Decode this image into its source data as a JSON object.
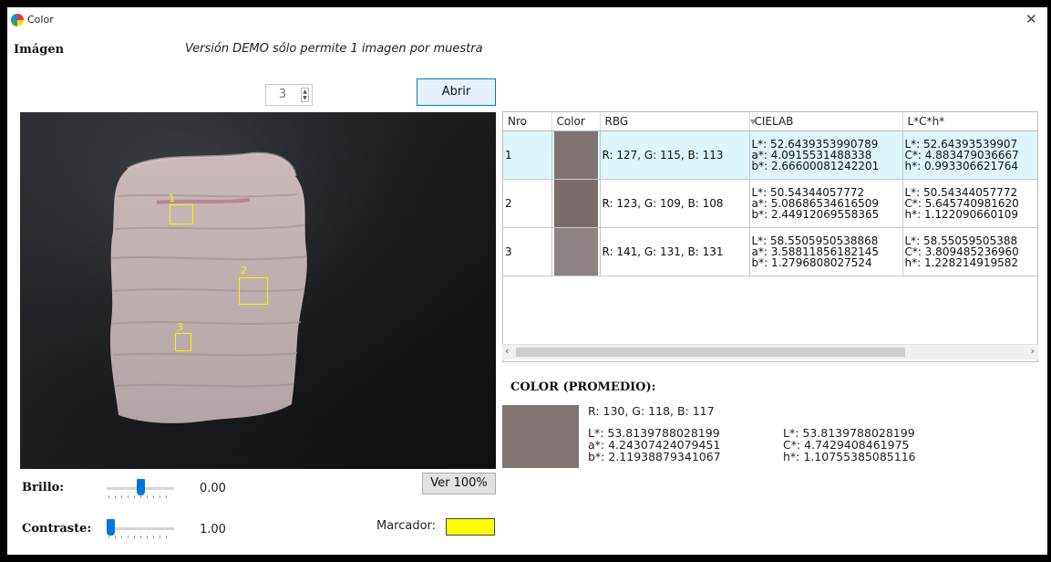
{
  "window": {
    "title": "Color",
    "close_glyph": "✕"
  },
  "image_section": {
    "label": "Imágen",
    "demo_note": "Versión DEMO sólo permite 1 imagen por muestra",
    "sample_count": "3",
    "open_button": "Abrir",
    "view_100_button": "Ver 100%"
  },
  "photo": {
    "markers": [
      {
        "label": "1"
      },
      {
        "label": "2"
      },
      {
        "label": "3"
      }
    ]
  },
  "controls": {
    "brightness_label": "Brillo:",
    "brightness_value": "0.00",
    "brightness_level": 0.5,
    "contrast_label": "Contraste:",
    "contrast_value": "1.00",
    "contrast_level": 0.0,
    "marker_label": "Marcador:",
    "marker_color": "#ffff00"
  },
  "table": {
    "columns": [
      "Nro",
      "Color",
      "RBG",
      "CIELAB",
      "L*C*h*"
    ],
    "rows": [
      {
        "nro": "1",
        "color": "#7f7371",
        "rgb": "R: 127, G: 115, B: 113",
        "lab": [
          "L*: 52.6439353990789",
          "a*: 4.0915531488338",
          "b*: 2.66600081242201"
        ],
        "lch": [
          "L*: 52.64393539907",
          "C*: 4.883479036667",
          "h*: 0.993306621764"
        ],
        "selected": true
      },
      {
        "nro": "2",
        "color": "#7b6d6c",
        "rgb": "R: 123, G: 109, B: 108",
        "lab": [
          "L*: 50.54344057772",
          "a*: 5.08686534616509",
          "b*: 2.44912069558365"
        ],
        "lch": [
          "L*: 50.54344057772",
          "C*: 5.645740981620",
          "h*: 1.122090660109"
        ],
        "selected": false
      },
      {
        "nro": "3",
        "color": "#8d8383",
        "rgb": "R: 141, G: 131, B: 131",
        "lab": [
          "L*: 58.5505950538868",
          "a*: 3.58811856182145",
          "b*: 1.2796808027524"
        ],
        "lch": [
          "L*: 58.55059505388",
          "C*: 3.809485236960",
          "h*: 1.228214919582"
        ],
        "selected": false
      }
    ]
  },
  "average": {
    "title": "COLOR (PROMEDIO):",
    "color": "#827675",
    "rgb": "R: 130, G: 118, B: 117",
    "lab": [
      "L*: 53.8139788028199",
      "a*: 4.24307424079451",
      "b*: 2.11938879341067"
    ],
    "lch": [
      "L*: 53.8139788028199",
      "C*: 4.7429408461975",
      "h*: 1.10755385085116"
    ]
  }
}
